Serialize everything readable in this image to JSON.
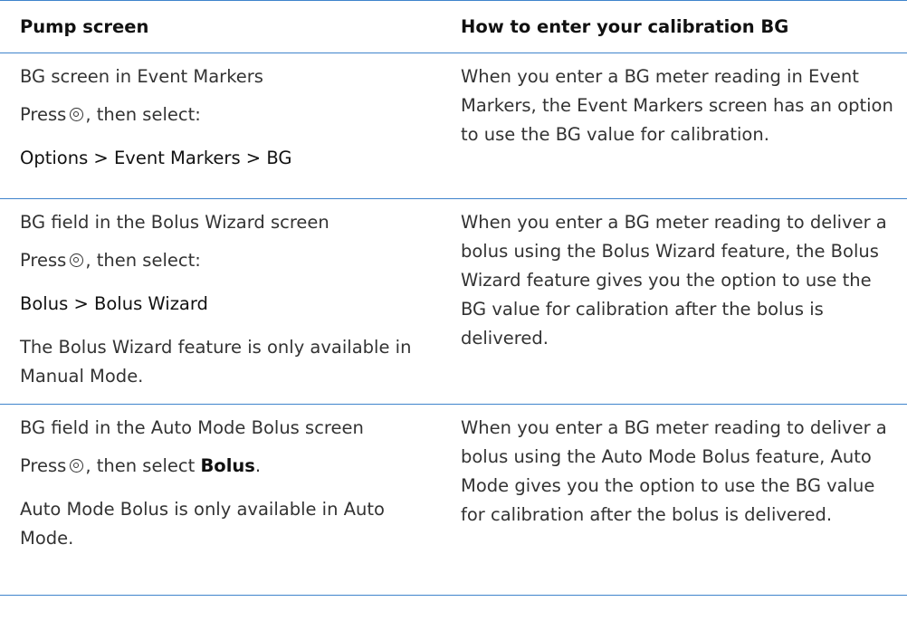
{
  "table": {
    "headers": [
      "Pump screen",
      "How to enter your calibration BG"
    ],
    "rows": [
      {
        "screen": "BG screen in Event Markers",
        "press_prefix": "Press",
        "press_suffix": ", then select:",
        "path": "Options > Event Markers > BG",
        "note": "",
        "description": "When you enter a BG meter reading in Event Markers, the Event Markers screen has an option to use the BG value for calibration."
      },
      {
        "screen": "BG field in the Bolus Wizard screen",
        "press_prefix": "Press",
        "press_suffix": ", then select:",
        "path": "Bolus > Bolus Wizard",
        "note": "The Bolus Wizard feature is only available in Manual Mode.",
        "description": "When you enter a BG meter reading to deliver a bolus using the Bolus Wizard feature, the Bolus Wizard feature gives you the option to use the BG value for calibration after the bolus is delivered."
      },
      {
        "screen": "BG field in the Auto Mode Bolus screen",
        "press_prefix": "Press",
        "press_suffix": ", then select",
        "press_bold": "Bolus",
        "press_end": ".",
        "note": "Auto Mode Bolus is only available in Auto Mode.",
        "description": "When you enter a BG meter reading to deliver a bolus using the Auto Mode Bolus feature, Auto Mode gives you the option to use the BG value for calibration after the bolus is delivered."
      }
    ]
  },
  "icons": {
    "select_button": "select-button-icon"
  },
  "colors": {
    "rule": "#3f84cc",
    "text": "#333333",
    "heading": "#111111"
  }
}
